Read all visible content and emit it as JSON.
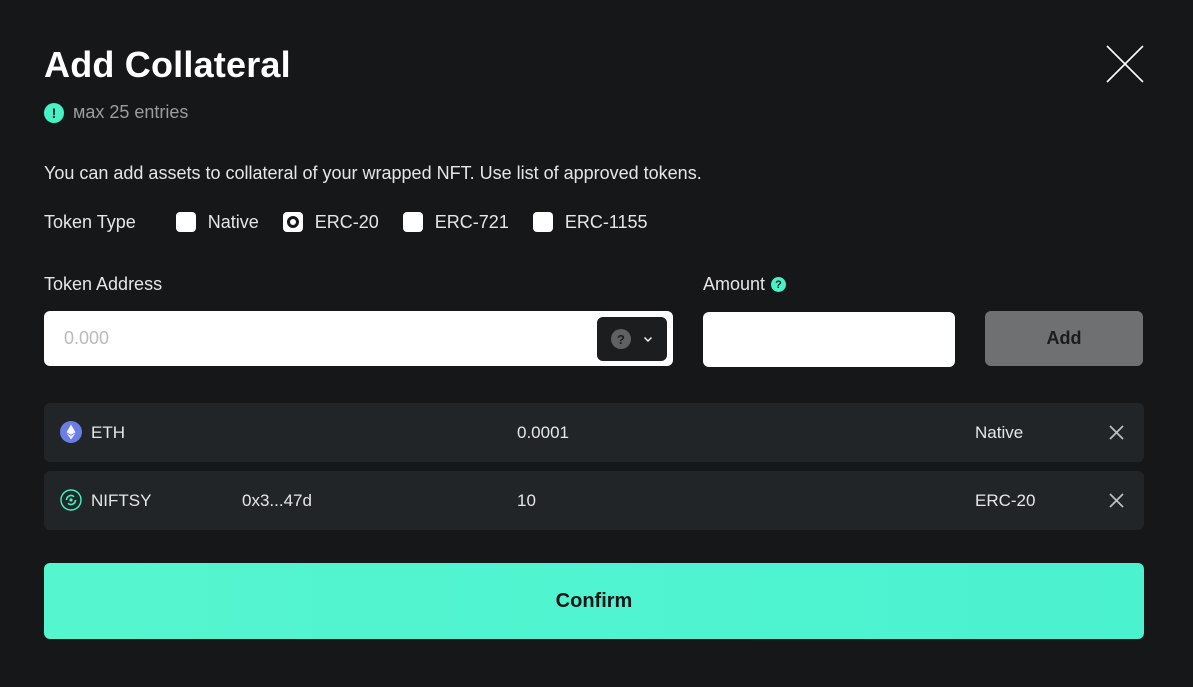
{
  "modal": {
    "title": "Add Collateral",
    "note": "мax 25 entries",
    "description": "You can add assets to collateral of your wrapped NFT. Use list of approved tokens."
  },
  "token_type": {
    "label": "Token Type",
    "options": [
      {
        "label": "Native",
        "checked": false
      },
      {
        "label": "ERC-20",
        "checked": true
      },
      {
        "label": "ERC-721",
        "checked": false
      },
      {
        "label": "ERC-1155",
        "checked": false
      }
    ]
  },
  "form": {
    "address_label": "Token Address",
    "address_placeholder": "0.000",
    "address_value": "",
    "token_select_icon": "question-icon",
    "amount_label": "Amount",
    "amount_value": "",
    "add_label": "Add"
  },
  "collateral": [
    {
      "icon": "eth-icon",
      "name": "ETH",
      "address": "",
      "amount": "0.0001",
      "type": "Native"
    },
    {
      "icon": "niftsy-icon",
      "name": "NIFTSY",
      "address": "0x3...47d",
      "amount": "10",
      "type": "ERC-20"
    }
  ],
  "confirm_label": "Confirm",
  "colors": {
    "background": "#161718",
    "accent": "#47f2c6",
    "row_bg": "#222527",
    "disabled_button": "#6f7071"
  }
}
